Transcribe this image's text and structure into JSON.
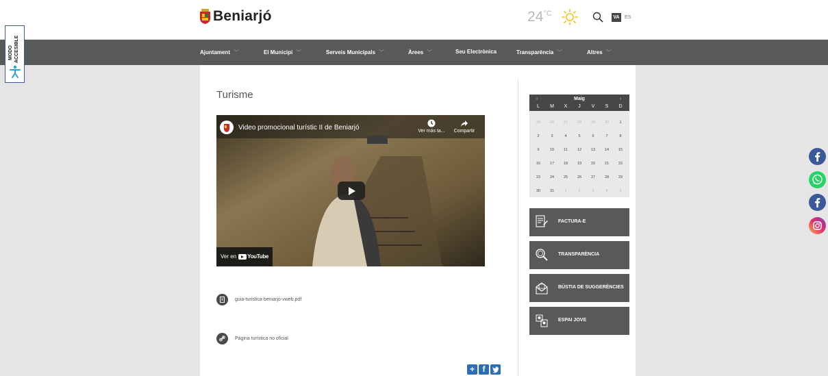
{
  "header": {
    "site_name": "Beniarjó",
    "temperature": "24",
    "temperature_unit": "°C",
    "weather_icon": "sun-icon",
    "lang_active": "VA",
    "lang_other": "ES"
  },
  "accessibility": {
    "line1": "MODO",
    "line2": "ACCESIBLE"
  },
  "nav": [
    {
      "label": "Ajuntament",
      "dropdown": true
    },
    {
      "label": "El Municipi",
      "dropdown": true
    },
    {
      "label": "Serveis Municipals",
      "dropdown": true
    },
    {
      "label": "Àrees",
      "dropdown": true
    },
    {
      "label": "Seu Electrònica",
      "dropdown": false
    },
    {
      "label": "Transparència",
      "dropdown": true
    },
    {
      "label": "Altres",
      "dropdown": true
    }
  ],
  "main": {
    "title": "Turisme",
    "video": {
      "title": "Video promocional turístic II de Beniarjó",
      "watch_later": "Ver más ta...",
      "share": "Compartir",
      "watch_on": "Ver en",
      "platform": "YouTube"
    },
    "links": [
      {
        "label": "guia-turistica-beniarjo-vweb.pdf",
        "icon": "file-icon"
      },
      {
        "label": "Pàgina turística no oficial",
        "icon": "link-icon"
      }
    ]
  },
  "calendar": {
    "month": "Maig",
    "prev": "‹",
    "next": "›",
    "weekdays": [
      "L",
      "M",
      "X",
      "J",
      "V",
      "S",
      "D"
    ],
    "weeks": [
      [
        "25",
        "26",
        "27",
        "28",
        "29",
        "30",
        "1"
      ],
      [
        "2",
        "3",
        "4",
        "5",
        "6",
        "7",
        "8"
      ],
      [
        "9",
        "10",
        "11",
        "12",
        "13",
        "14",
        "15"
      ],
      [
        "16",
        "17",
        "18",
        "19",
        "20",
        "21",
        "22"
      ],
      [
        "23",
        "24",
        "25",
        "26",
        "27",
        "28",
        "29"
      ],
      [
        "30",
        "31",
        "1",
        "2",
        "3",
        "4",
        "5"
      ]
    ]
  },
  "sidebar": {
    "buttons": [
      {
        "label": "FACTURA-E",
        "icon": "invoice-icon"
      },
      {
        "label": "TRANSPARÈNCIA",
        "icon": "magnifier-icon"
      },
      {
        "label": "BÚSTIA DE SUGGERÈNCIES",
        "icon": "mailbox-icon"
      },
      {
        "label": "ESPAI JOVE",
        "icon": "youth-icon"
      }
    ]
  },
  "social": [
    "facebook-icon",
    "whatsapp-icon",
    "facebook-icon",
    "instagram-icon"
  ],
  "share": [
    "+",
    "f",
    "t"
  ],
  "colors": {
    "nav_bg": "#58595b",
    "calendar_head": "#474747",
    "share_blue": "#2f6db5",
    "facebook": "#3b5998",
    "whatsapp": "#25d366"
  }
}
